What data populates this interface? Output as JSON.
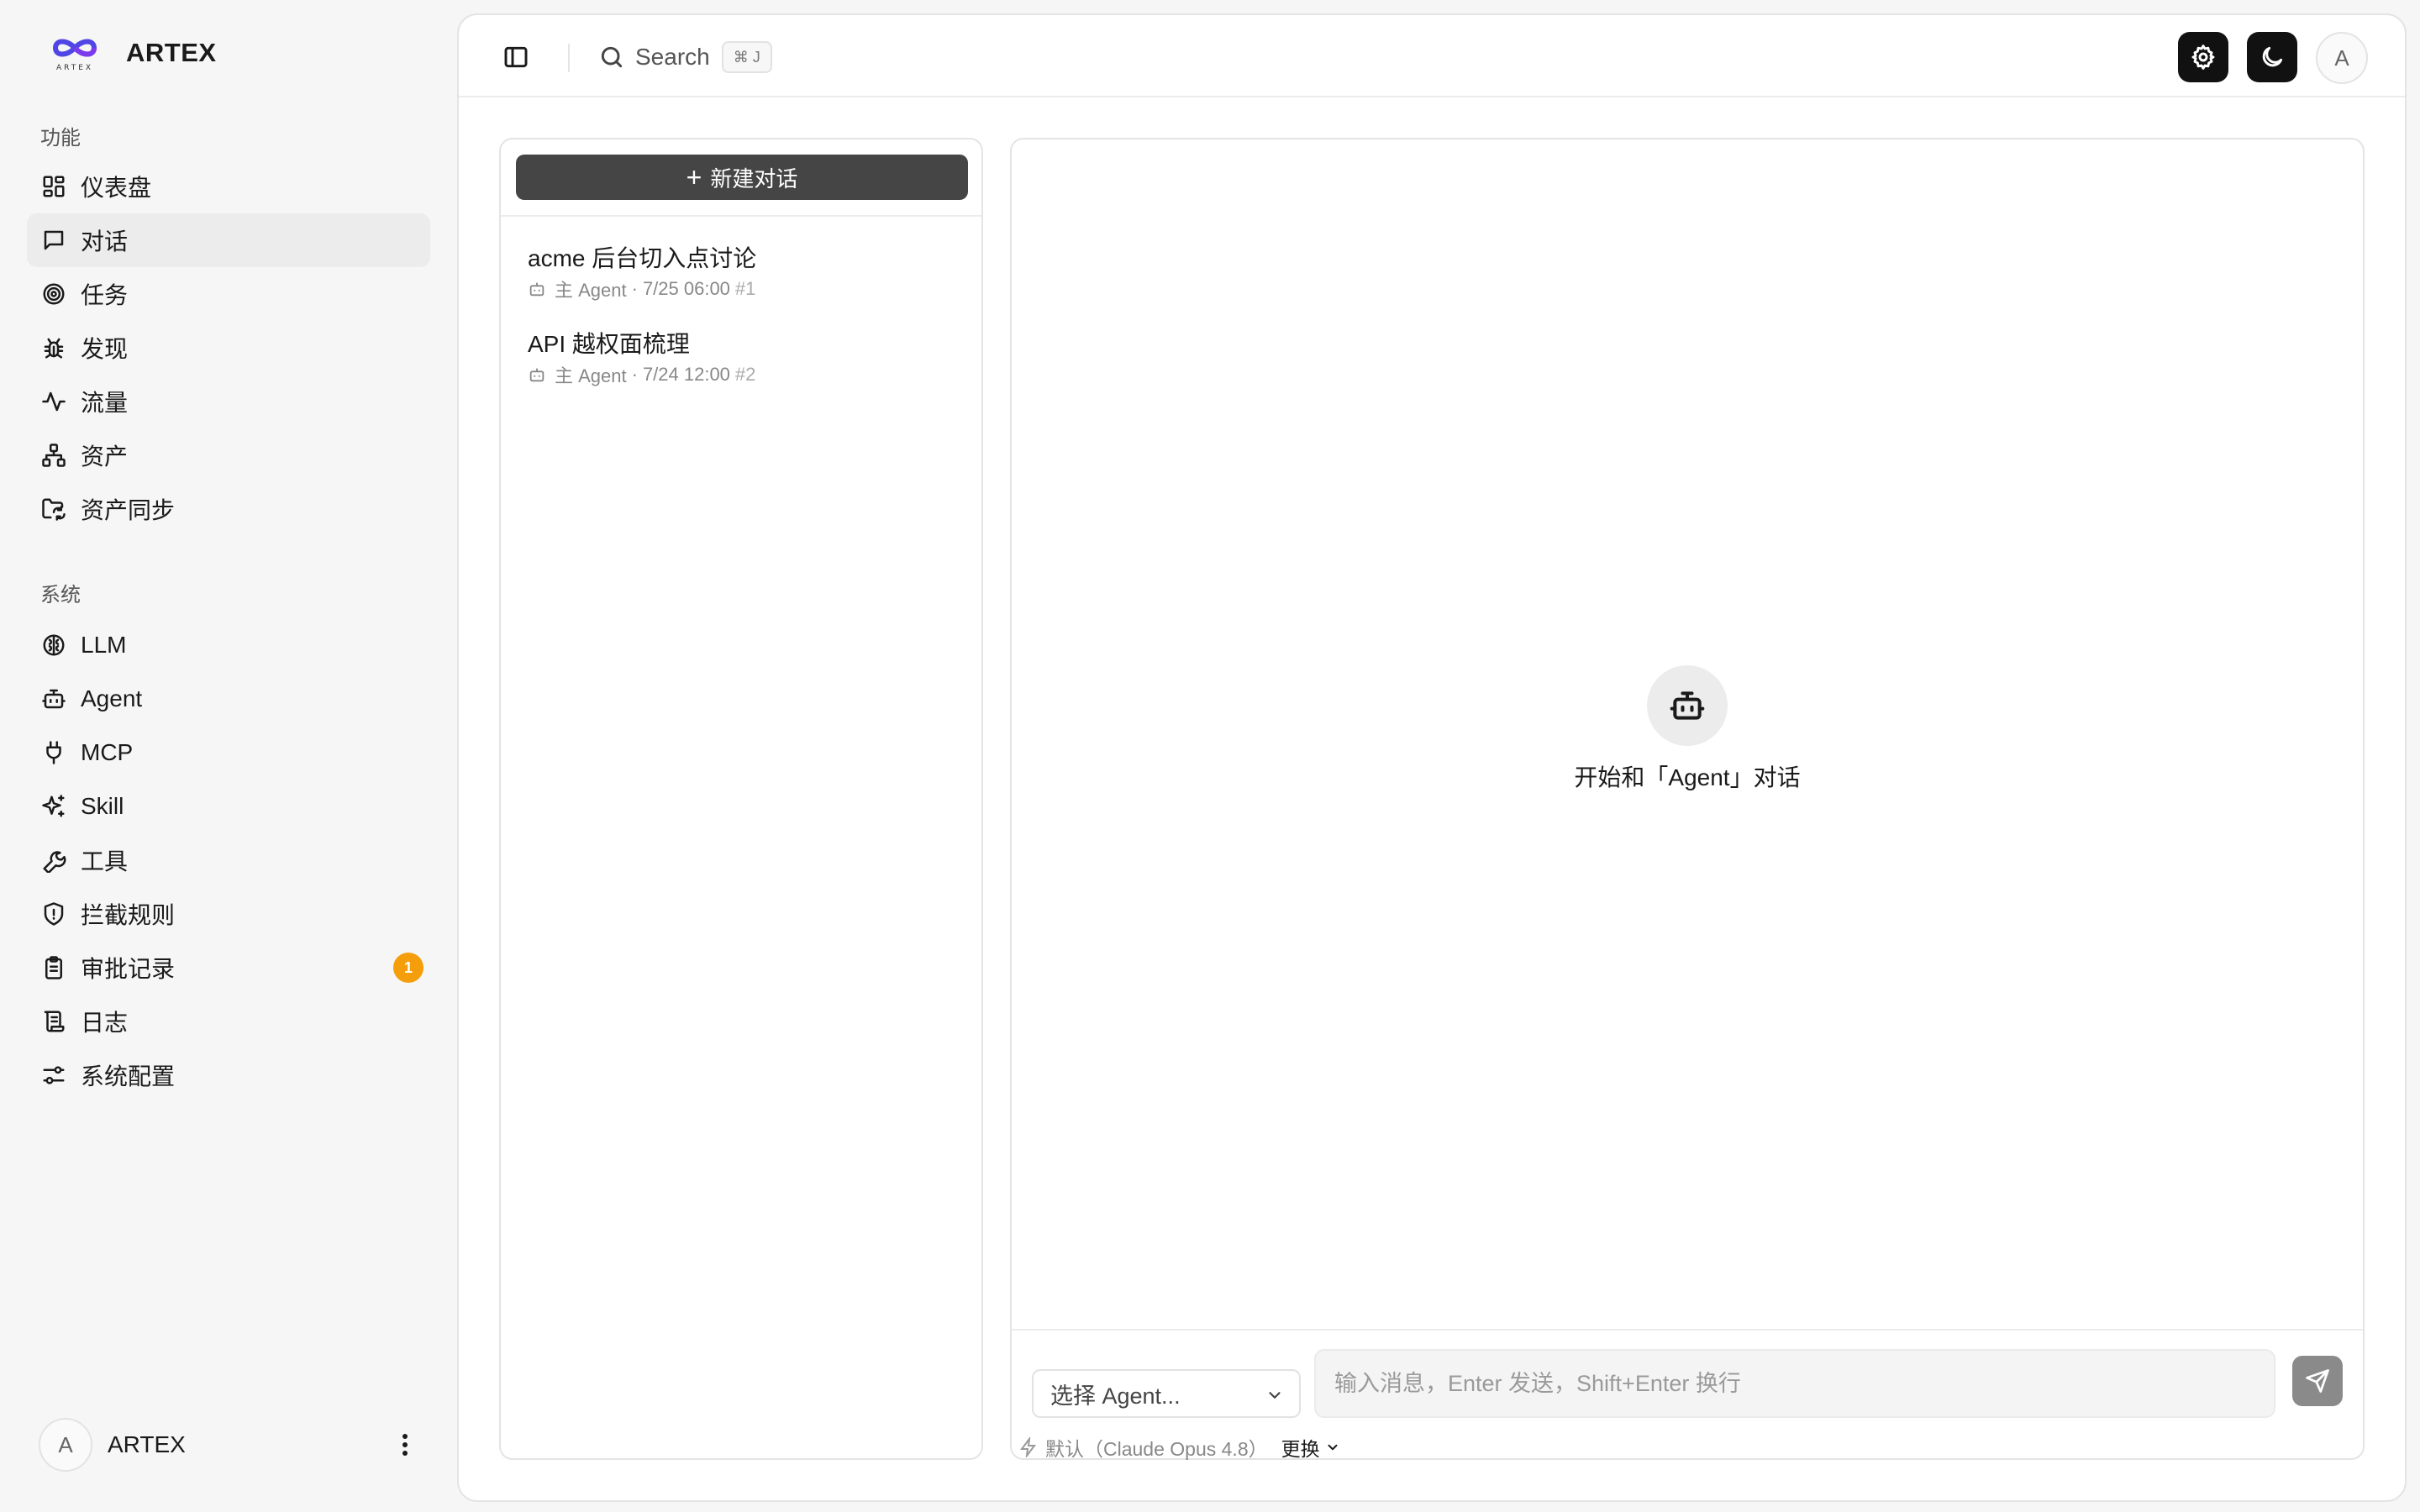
{
  "brand": {
    "name": "ARTEX",
    "logo_text": "ARTEX",
    "logo_color": "#4f46e5"
  },
  "sidebar": {
    "section_features": "功能",
    "features": [
      {
        "label": "仪表盘",
        "icon": "dashboard-icon"
      },
      {
        "label": "对话",
        "icon": "chat-icon",
        "active": true
      },
      {
        "label": "任务",
        "icon": "target-icon"
      },
      {
        "label": "发现",
        "icon": "bug-icon"
      },
      {
        "label": "流量",
        "icon": "activity-icon"
      },
      {
        "label": "资产",
        "icon": "network-icon"
      },
      {
        "label": "资产同步",
        "icon": "folder-sync-icon"
      }
    ],
    "section_system": "系统",
    "system": [
      {
        "label": "LLM",
        "icon": "brain-icon"
      },
      {
        "label": "Agent",
        "icon": "bot-icon"
      },
      {
        "label": "MCP",
        "icon": "plug-icon"
      },
      {
        "label": "Skill",
        "icon": "sparkles-icon"
      },
      {
        "label": "工具",
        "icon": "wrench-icon"
      },
      {
        "label": "拦截规则",
        "icon": "shield-icon"
      },
      {
        "label": "审批记录",
        "icon": "clipboard-icon",
        "badge": "1"
      },
      {
        "label": "日志",
        "icon": "scroll-icon"
      },
      {
        "label": "系统配置",
        "icon": "settings-sliders-icon"
      }
    ],
    "user": {
      "avatar": "A",
      "name": "ARTEX"
    }
  },
  "topbar": {
    "search_label": "Search",
    "shortcut": "⌘ J",
    "avatar": "A"
  },
  "conversations": {
    "new_button": "新建对话",
    "items": [
      {
        "title": "acme 后台切入点讨论",
        "agent": "主 Agent",
        "time": "7/25 06:00",
        "number": "#1"
      },
      {
        "title": "API 越权面梳理",
        "agent": "主 Agent",
        "time": "7/24 12:00",
        "number": "#2"
      }
    ]
  },
  "chat": {
    "empty_text": "开始和「Agent」对话",
    "agent_select": "选择 Agent...",
    "input_placeholder": "输入消息，Enter 发送，Shift+Enter 换行",
    "model_label": "默认（Claude Opus 4.8）",
    "change_label": "更换"
  }
}
